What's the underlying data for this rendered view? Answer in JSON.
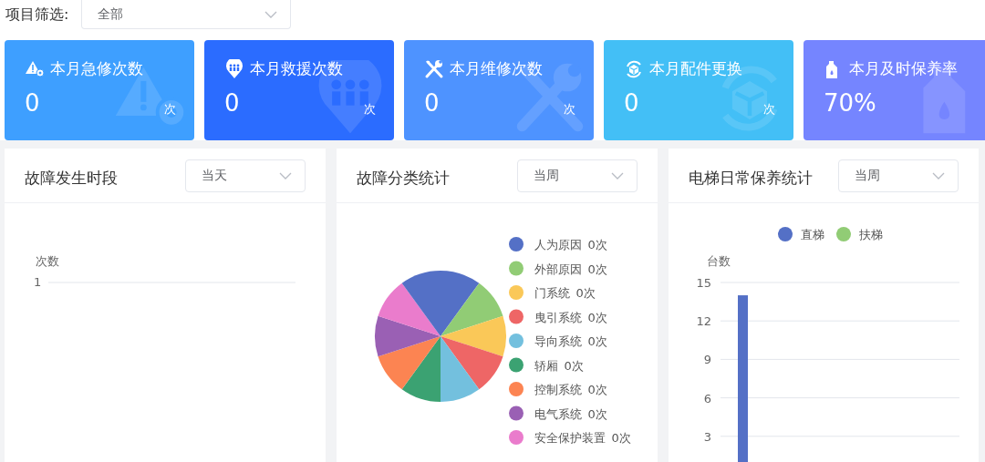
{
  "filter": {
    "label": "项目筛选:",
    "value": "全部"
  },
  "cards": [
    {
      "kind": "alert",
      "title": "本月急修次数",
      "value": "0",
      "unit": "次",
      "color": "#3e9fff"
    },
    {
      "kind": "rescue",
      "title": "本月救援次数",
      "value": "0",
      "unit": "次",
      "color": "#2b6cff"
    },
    {
      "kind": "repair",
      "title": "本月维修次数",
      "value": "0",
      "unit": "次",
      "color": "#4e93ff"
    },
    {
      "kind": "parts",
      "title": "本月配件更换",
      "value": "0",
      "unit": "次",
      "color": "#43bff6"
    },
    {
      "kind": "oil",
      "title": "本月及时保养率",
      "value": "70%",
      "color": "#7585ff"
    }
  ],
  "panels": [
    {
      "kind": "line",
      "title": "故障发生时段",
      "period": "当天",
      "y_axis_label": "次数",
      "y_tick": "1"
    },
    {
      "kind": "pie",
      "title": "故障分类统计",
      "period": "当周",
      "legend": [
        {
          "label": "人为原因",
          "count": "0次",
          "color": "#5470c6"
        },
        {
          "label": "外部原因",
          "count": "0次",
          "color": "#91cc75"
        },
        {
          "label": "门系统",
          "count": "0次",
          "color": "#fac858"
        },
        {
          "label": "曳引系统",
          "count": "0次",
          "color": "#ee6666"
        },
        {
          "label": "导向系统",
          "count": "0次",
          "color": "#73c0de"
        },
        {
          "label": "轿厢",
          "count": "0次",
          "color": "#3ba272"
        },
        {
          "label": "控制系统",
          "count": "0次",
          "color": "#fc8452"
        },
        {
          "label": "电气系统",
          "count": "0次",
          "color": "#9a60b4"
        },
        {
          "label": "安全保护装置",
          "count": "0次",
          "color": "#ea7ccc"
        }
      ]
    },
    {
      "kind": "bar",
      "title": "电梯日常保养统计",
      "period": "当周",
      "chart_data": {
        "type": "bar",
        "ylabel": "台数",
        "yticks": [
          3,
          6,
          9,
          12,
          15
        ],
        "ylim": [
          0,
          15
        ],
        "grid": true,
        "series": [
          {
            "name": "直梯",
            "color": "#5470c6",
            "values": [
              14
            ]
          },
          {
            "name": "扶梯",
            "color": "#91cc75",
            "values": [
              0
            ]
          }
        ]
      }
    }
  ]
}
